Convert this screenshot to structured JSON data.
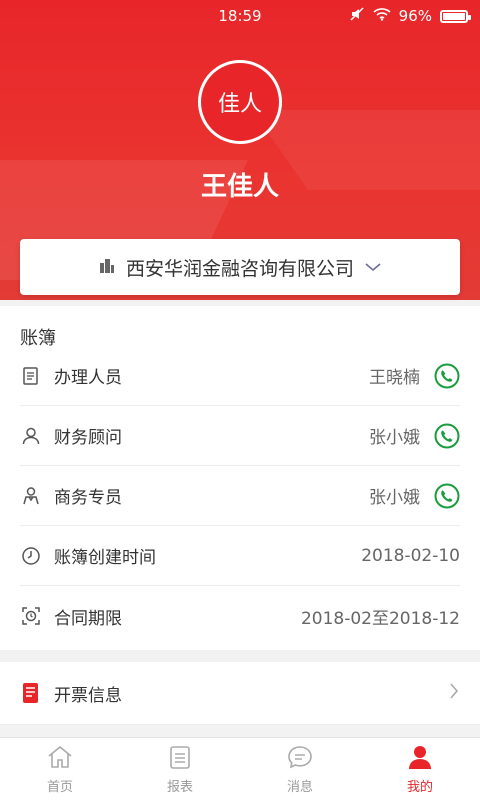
{
  "status_bar": {
    "time": "18:59",
    "battery": "96%"
  },
  "profile": {
    "avatar_text": "佳人",
    "name": "王佳人"
  },
  "company": {
    "name": "西安华润金融咨询有限公司"
  },
  "ledger": {
    "title": "账簿",
    "rows": [
      {
        "label": "办理人员",
        "value": "王晓楠"
      },
      {
        "label": "财务顾问",
        "value": "张小娥"
      },
      {
        "label": "商务专员",
        "value": "张小娥"
      },
      {
        "label": "账簿创建时间",
        "value": "2018-02-10"
      },
      {
        "label": "合同期限",
        "value": "2018-02至2018-12"
      }
    ]
  },
  "invoice": {
    "label": "开票信息"
  },
  "tabs": [
    {
      "label": "首页"
    },
    {
      "label": "报表"
    },
    {
      "label": "消息"
    },
    {
      "label": "我的"
    }
  ],
  "colors": {
    "brand_red": "#e8262a",
    "phone_green": "#1a9c3e"
  }
}
